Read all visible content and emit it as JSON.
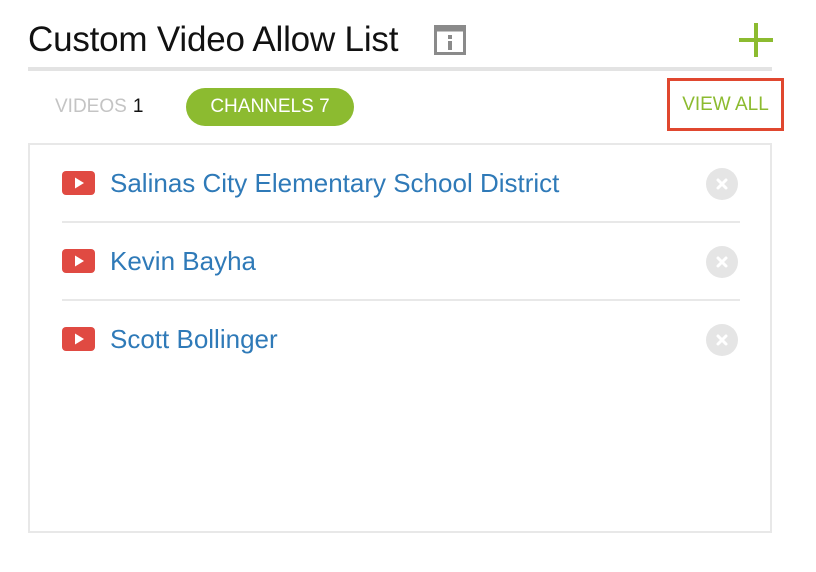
{
  "header": {
    "title": "Custom Video Allow List",
    "info_icon": "info-window-icon",
    "add_icon": "plus-icon"
  },
  "tabs": {
    "videos_label": "VIDEOS",
    "videos_count": "1",
    "channels_label": "CHANNELS 7",
    "view_all": "VIEW ALL"
  },
  "channels": [
    {
      "name": "Salinas City Elementary School District",
      "icon": "youtube-icon"
    },
    {
      "name": "Kevin Bayha",
      "icon": "youtube-icon"
    },
    {
      "name": "Scott Bollinger",
      "icon": "youtube-icon"
    }
  ],
  "colors": {
    "accent_green": "#8cbb30",
    "link_blue": "#2f7ab8",
    "youtube_red": "#e04a42",
    "highlight_red": "#e0472f"
  }
}
